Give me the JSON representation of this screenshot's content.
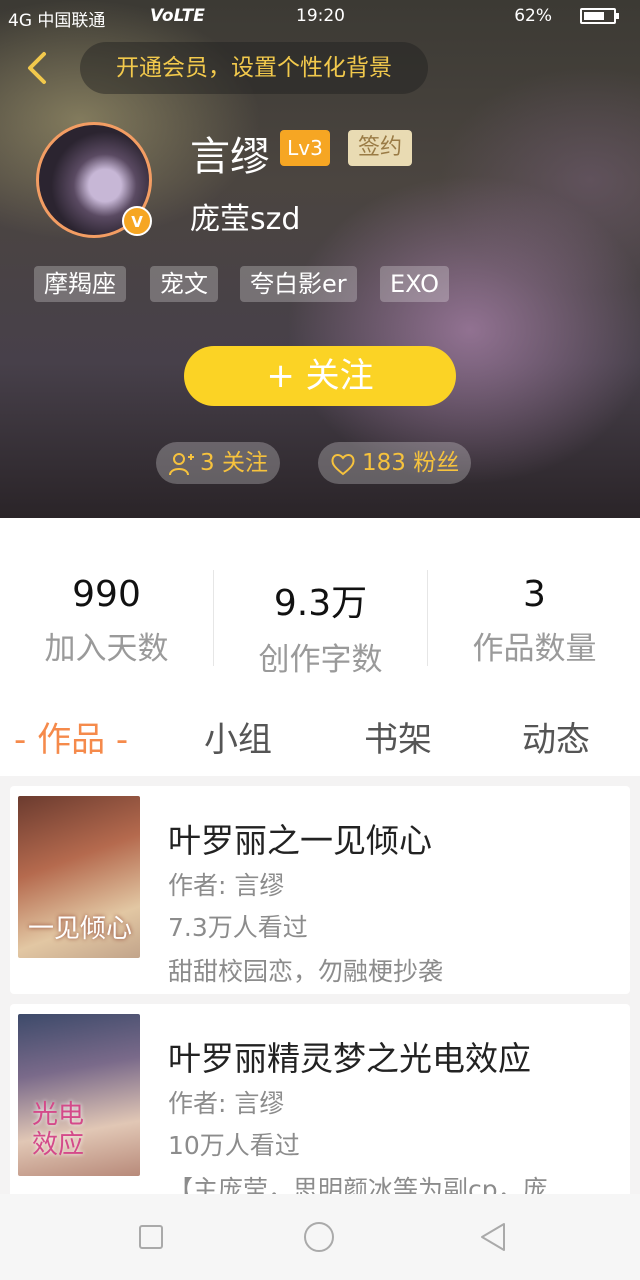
{
  "status_bar": {
    "left": "4G 中国联通",
    "volte": "VoLTE",
    "time": "19:20",
    "battery": "62%"
  },
  "header": {
    "vip_banner": "开通会员，设置个性化背景",
    "username": "言缪",
    "level": "Lv3",
    "signed": "签约",
    "handle": "庞莹szd",
    "verified_badge": "V",
    "tags": [
      "摩羯座",
      "宠文",
      "夸白影er",
      "EXO"
    ],
    "follow_button": "+ 关注",
    "following": "3 关注",
    "fans": "183 粉丝"
  },
  "stats": [
    {
      "value": "990",
      "label": "加入天数"
    },
    {
      "value": "9.3万",
      "label": "创作字数"
    },
    {
      "value": "3",
      "label": "作品数量"
    }
  ],
  "tabs": [
    {
      "label": "- 作品 -",
      "active": true
    },
    {
      "label": "小组",
      "active": false
    },
    {
      "label": "书架",
      "active": false
    },
    {
      "label": "动态",
      "active": false
    }
  ],
  "books": [
    {
      "title": "叶罗丽之一见倾心",
      "author": "作者: 言缪",
      "views": "7.3万人看过",
      "desc": "甜甜校园恋，勿融梗抄袭",
      "cover_text": "一见倾心"
    },
    {
      "title": "叶罗丽精灵梦之光电效应",
      "author": "作者: 言缪",
      "views": "10万人看过",
      "desc": "【主庞莹，思明颜冰等为副cp，庞...",
      "cover_text": "光电效应"
    }
  ],
  "colors": {
    "accent_orange": "#f58a4b",
    "follow_yellow": "#fbd325",
    "vip_gold": "#f2c94c"
  }
}
